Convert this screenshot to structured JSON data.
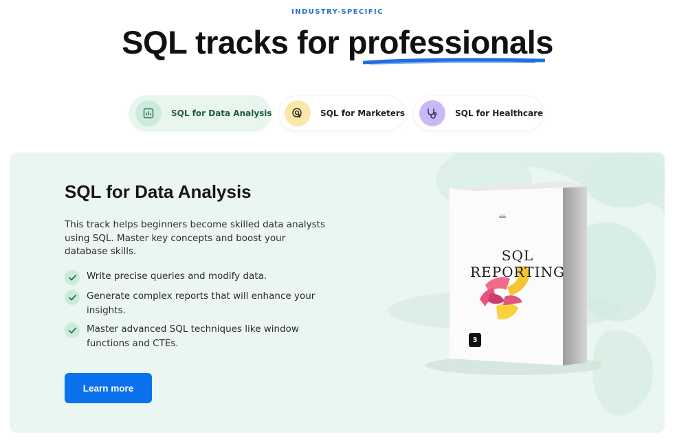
{
  "header": {
    "eyebrow": "INDUSTRY-SPECIFIC",
    "title_prefix": "SQL tracks for ",
    "title_highlight": "professionals"
  },
  "tabs": [
    {
      "label": "SQL for Data Analysis",
      "icon": "bar-chart-icon",
      "icon_bg": "#cdebdc",
      "active": true
    },
    {
      "label": "SQL for Marketers",
      "icon": "target-cursor-icon",
      "icon_bg": "#fbe7a9",
      "active": false
    },
    {
      "label": "SQL for Healthcare",
      "icon": "stethoscope-icon",
      "icon_bg": "#c8b9f5",
      "active": false
    }
  ],
  "panel": {
    "title": "SQL for Data Analysis",
    "description": "This track helps beginners become skilled data analysts using SQL. Master key concepts and boost your database skills.",
    "features": [
      "Write precise queries and modify data.",
      "Generate complex reports that will enhance your insights.",
      "Master advanced SQL techniques like window functions and CTEs."
    ],
    "cta_label": "Learn more",
    "product": {
      "title_line1": "SQL",
      "title_line2": "REPORTING",
      "volume": "3"
    }
  },
  "colors": {
    "accent_blue": "#0b72ee",
    "eyebrow_blue": "#2a6fd6",
    "panel_bg": "#eaf6f1",
    "check_bg": "#cdebdc"
  }
}
